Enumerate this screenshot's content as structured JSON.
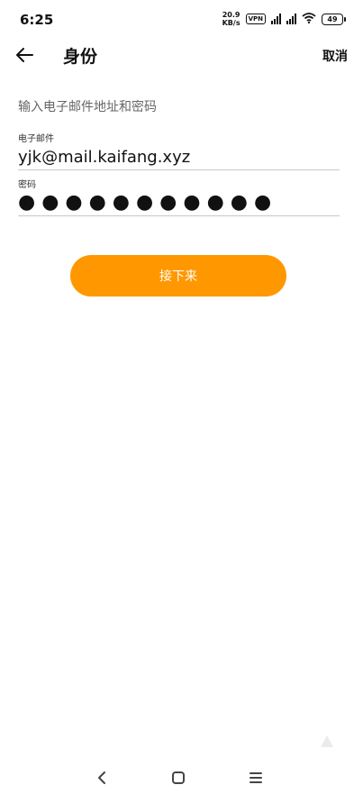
{
  "status_bar": {
    "time": "6:25",
    "net_speed_value": "20.9",
    "net_speed_unit": "KB/s",
    "vpn": "VPN",
    "battery": "49"
  },
  "app_bar": {
    "title": "身份",
    "cancel_label": "取消"
  },
  "form": {
    "instruction": "输入电子邮件地址和密码",
    "email_label": "电子邮件",
    "email_value": "yjk@mail.kaifang.xyz",
    "password_label": "密码",
    "password_masked": "●●●●●●●●●●●"
  },
  "next_button_label": "接下来",
  "colors": {
    "accent": "#FF9800",
    "divider": "#c8c8c8"
  }
}
